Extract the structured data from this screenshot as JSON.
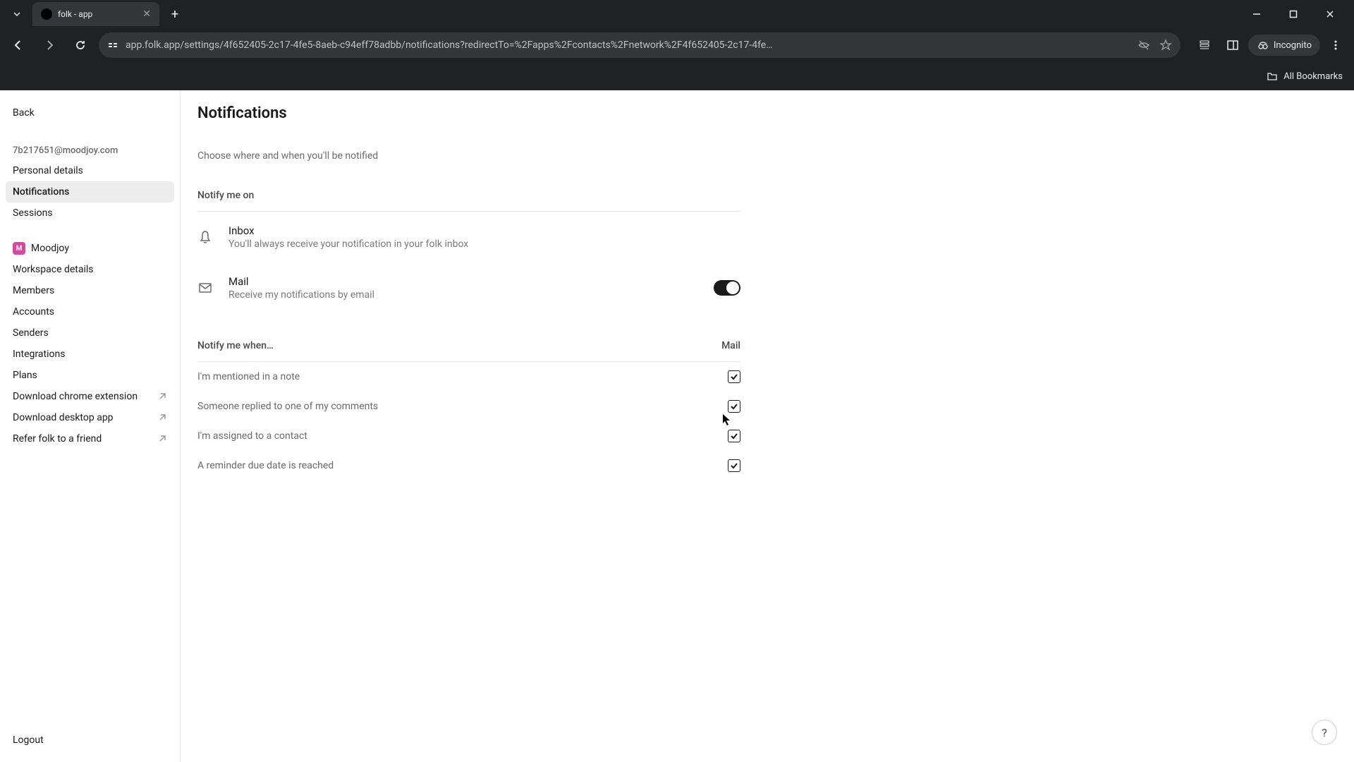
{
  "browser": {
    "tab_title": "folk - app",
    "url": "app.folk.app/settings/4f652405-2c17-4fe5-8aeb-c94eff78adbb/notifications?redirectTo=%2Fapps%2Fcontacts%2Fnetwork%2F4f652405-2c17-4fe…",
    "incognito": "Incognito",
    "all_bookmarks": "All Bookmarks"
  },
  "sidebar": {
    "back": "Back",
    "email": "7b217651@moodjoy.com",
    "personal": [
      {
        "label": "Personal details"
      },
      {
        "label": "Notifications"
      },
      {
        "label": "Sessions"
      }
    ],
    "workspace_name": "Moodjoy",
    "workspace_initial": "M",
    "workspace": [
      {
        "label": "Workspace details"
      },
      {
        "label": "Members"
      },
      {
        "label": "Accounts"
      },
      {
        "label": "Senders"
      },
      {
        "label": "Integrations"
      },
      {
        "label": "Plans"
      },
      {
        "label": "Download chrome extension"
      },
      {
        "label": "Download desktop app"
      },
      {
        "label": "Refer folk to a friend"
      }
    ],
    "logout": "Logout"
  },
  "main": {
    "title": "Notifications",
    "subtitle": "Choose where and when you'll be notified",
    "notify_on_heading": "Notify me on",
    "channels": [
      {
        "title": "Inbox",
        "desc": "You'll always receive your notification in your folk inbox"
      },
      {
        "title": "Mail",
        "desc": "Receive my notifications by email"
      }
    ],
    "notify_when_heading": "Notify me when…",
    "mail_col": "Mail",
    "when_rows": [
      {
        "label": "I'm mentioned in a note"
      },
      {
        "label": "Someone replied to one of my comments"
      },
      {
        "label": "I'm assigned to a contact"
      },
      {
        "label": "A reminder due date is reached"
      }
    ],
    "help": "?"
  }
}
